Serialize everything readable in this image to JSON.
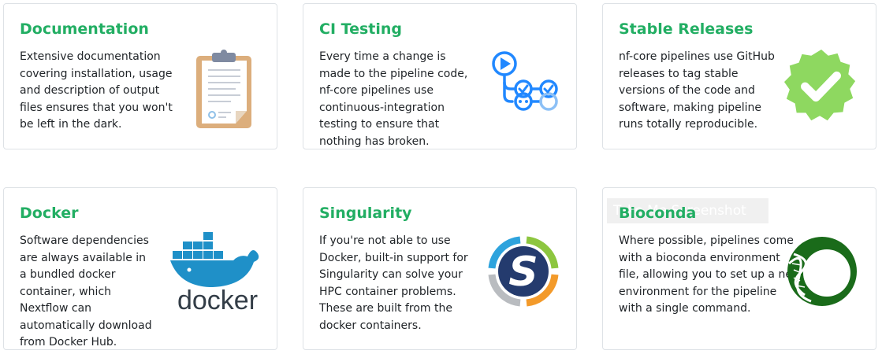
{
  "cards": [
    {
      "title": "Documentation",
      "text": "Extensive documentation covering installation, usage and description of output files ensures that you won't be left in the dark.",
      "icon": "clipboard-icon"
    },
    {
      "title": "CI Testing",
      "text": "Every time a change is made to the pipeline code, nf-core pipelines use continuous-integration testing to ensure that nothing has broken.",
      "icon": "github-actions-icon"
    },
    {
      "title": "Stable Releases",
      "text": "nf-core pipelines use GitHub releases to tag stable versions of the code and software, making pipeline runs totally reproducible.",
      "icon": "verified-badge-icon"
    },
    {
      "title": "Docker",
      "text": "Software dependencies are always available in a bundled docker container, which Nextflow can automatically download from Docker Hub.",
      "icon": "docker-logo-icon",
      "logo_text": "docker"
    },
    {
      "title": "Singularity",
      "text": "If you're not able to use Docker, built-in support for Singularity can solve your HPC container problems. These are built from the docker containers.",
      "icon": "singularity-logo-icon",
      "logo_letter": "S"
    },
    {
      "title": "Bioconda",
      "text": "Where possible, pipelines come with a bioconda environment file, allowing you to set up a new environment for the pipeline with a single command.",
      "icon": "bioconda-logo-icon"
    }
  ],
  "tooltip": "Take Me Screenshot",
  "colors": {
    "title_green": "#22ae63",
    "border": "#dee2e6",
    "ci_blue": "#2188ff",
    "badge_green": "#8ed860",
    "bioconda_green": "#1a6b1a"
  }
}
